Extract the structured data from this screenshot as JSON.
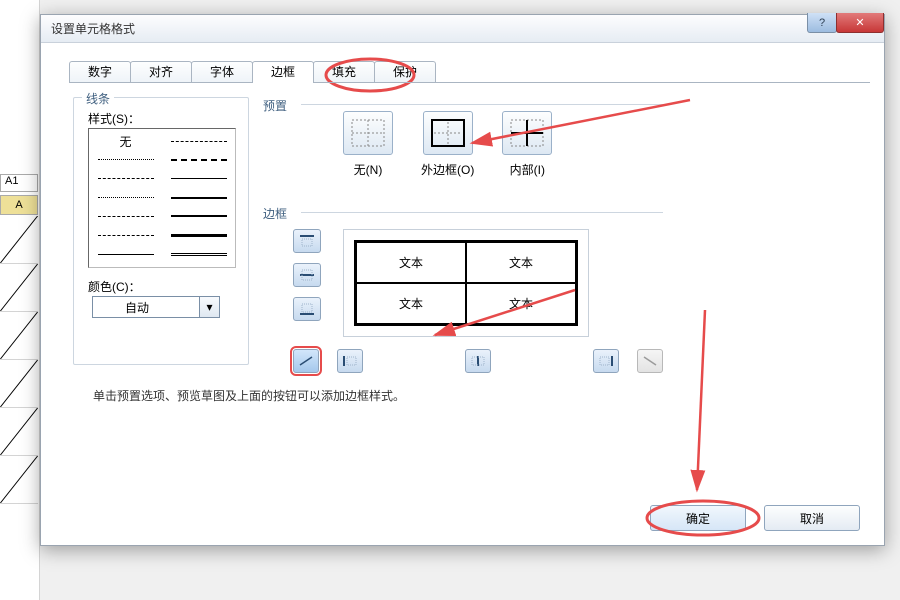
{
  "bg": {
    "cell_a1": "A1",
    "col_a": "A"
  },
  "dialog": {
    "title": "设置单元格格式",
    "tabs": [
      "数字",
      "对齐",
      "字体",
      "边框",
      "填充",
      "保护"
    ],
    "active_tab_index": 3,
    "lines": {
      "group": "线条",
      "style_label": "样式(S)：",
      "none_label": "无",
      "color_label": "颜色(C)：",
      "color_value": "自动"
    },
    "preset": {
      "group": "预置",
      "items": [
        {
          "id": "none",
          "label": "无(N)"
        },
        {
          "id": "outline",
          "label": "外边框(O)"
        },
        {
          "id": "inside",
          "label": "内部(I)"
        }
      ]
    },
    "border": {
      "group": "边框",
      "preview_text": "文本"
    },
    "hint": "单击预置选项、预览草图及上面的按钮可以添加边框样式。",
    "ok": "确定",
    "cancel": "取消"
  },
  "icons": {
    "close": "✕",
    "help": "?",
    "dropdown": "▾"
  },
  "annotation_color": "#e64b4b"
}
